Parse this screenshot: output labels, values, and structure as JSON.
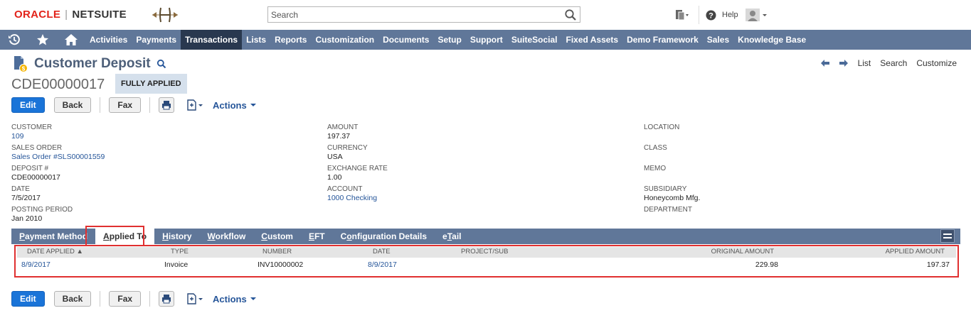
{
  "header": {
    "logo_oracle": "ORACLE",
    "logo_sep": "|",
    "logo_netsuite": "NETSUITE",
    "search_placeholder": "Search",
    "help_label": "Help"
  },
  "nav": {
    "items": [
      "Activities",
      "Payments",
      "Transactions",
      "Lists",
      "Reports",
      "Customization",
      "Documents",
      "Setup",
      "Support",
      "SuiteSocial",
      "Fixed Assets",
      "Demo Framework",
      "Sales",
      "Knowledge Base"
    ],
    "active": "Transactions"
  },
  "page": {
    "title": "Customer Deposit",
    "record_id": "CDE00000017",
    "status": "FULLY APPLIED",
    "links": {
      "list": "List",
      "search": "Search",
      "customize": "Customize"
    }
  },
  "buttons": {
    "edit": "Edit",
    "back": "Back",
    "fax": "Fax",
    "actions": "Actions"
  },
  "fields": {
    "col1": [
      {
        "label": "CUSTOMER",
        "value": "109",
        "link": true
      },
      {
        "label": "SALES ORDER",
        "value": "Sales Order #SLS00001559",
        "link": true
      },
      {
        "label": "DEPOSIT #",
        "value": "CDE00000017",
        "link": false
      },
      {
        "label": "DATE",
        "value": "7/5/2017",
        "link": false
      },
      {
        "label": "POSTING PERIOD",
        "value": "Jan 2010",
        "link": false
      }
    ],
    "col2": [
      {
        "label": "AMOUNT",
        "value": "197.37",
        "link": false
      },
      {
        "label": "CURRENCY",
        "value": "USA",
        "link": false
      },
      {
        "label": "EXCHANGE RATE",
        "value": "1.00",
        "link": false
      },
      {
        "label": "ACCOUNT",
        "value": "1000 Checking",
        "link": true
      }
    ],
    "col3": [
      {
        "label": "LOCATION",
        "value": "",
        "link": false
      },
      {
        "label": "CLASS",
        "value": "",
        "link": false
      },
      {
        "label": "MEMO",
        "value": "",
        "link": false
      },
      {
        "label": "SUBSIDIARY",
        "value": "Honeycomb Mfg.",
        "link": false
      },
      {
        "label": "DEPARTMENT",
        "value": "",
        "link": false
      }
    ]
  },
  "subtabs": {
    "items": [
      {
        "pre": "",
        "u": "P",
        "post": "ayment Method"
      },
      {
        "pre": "",
        "u": "A",
        "post": "pplied To"
      },
      {
        "pre": "",
        "u": "H",
        "post": "istory"
      },
      {
        "pre": "",
        "u": "W",
        "post": "orkflow"
      },
      {
        "pre": "",
        "u": "C",
        "post": "ustom"
      },
      {
        "pre": "",
        "u": "E",
        "post": "FT"
      },
      {
        "pre": "C",
        "u": "o",
        "post": "nfiguration Details"
      },
      {
        "pre": "e",
        "u": "T",
        "post": "ail"
      }
    ],
    "active_index": 1
  },
  "applied_table": {
    "headers": {
      "date_applied": "DATE APPLIED ▲",
      "type": "TYPE",
      "number": "NUMBER",
      "date": "DATE",
      "project": "PROJECT/SUB",
      "original_amount": "ORIGINAL AMOUNT",
      "applied_amount": "APPLIED AMOUNT"
    },
    "rows": [
      {
        "date_applied": "8/9/2017",
        "type": "Invoice",
        "number": "INV10000002",
        "date": "8/9/2017",
        "project": "",
        "original_amount": "229.98",
        "applied_amount": "197.37"
      }
    ]
  },
  "colors": {
    "nav_bg": "#607799",
    "nav_active": "#29384f",
    "title": "#4d5f79",
    "link": "#255599",
    "primary_button": "#1a74d8",
    "highlight": "#e03030"
  }
}
